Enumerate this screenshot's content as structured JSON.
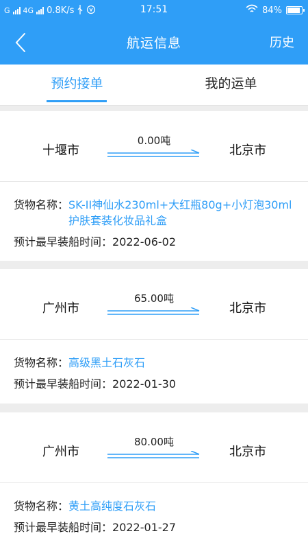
{
  "status_bar": {
    "carrier_g": "G",
    "network": "4G",
    "speed": "0.8K/s",
    "time": "17:51",
    "battery": "84%"
  },
  "header": {
    "title": "航运信息",
    "history_label": "历史"
  },
  "tabs": [
    {
      "label": "预约接单",
      "active": true
    },
    {
      "label": "我的运单",
      "active": false
    }
  ],
  "labels": {
    "cargo_name": "货物名称：",
    "earliest_loading": "预计最早装船时间："
  },
  "orders": [
    {
      "from": "十堰市",
      "to": "北京市",
      "tonnage": "0.00吨",
      "cargo": "SK-II神仙水230ml+大红瓶80g+小灯泡30ml护肤套装化妆品礼盒",
      "date": "2022-06-02"
    },
    {
      "from": "广州市",
      "to": "北京市",
      "tonnage": "65.00吨",
      "cargo": "高级黑土石灰石",
      "date": "2022-01-30"
    },
    {
      "from": "广州市",
      "to": "北京市",
      "tonnage": "80.00吨",
      "cargo": "黄土高纯度石灰石",
      "date": "2022-01-27"
    }
  ],
  "colors": {
    "accent": "#2f9ef7",
    "background": "#ededed"
  }
}
